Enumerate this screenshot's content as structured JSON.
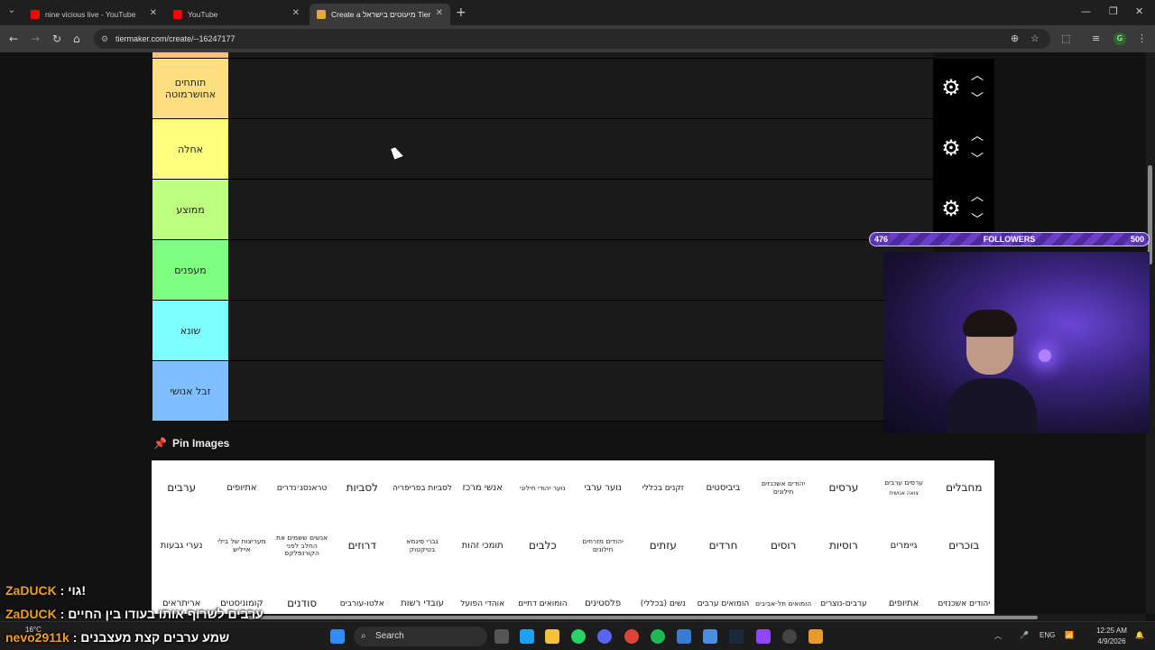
{
  "browser": {
    "tabs": [
      {
        "title": "nine vicious live - YouTube",
        "icon": "youtube-icon"
      },
      {
        "title": "YouTube",
        "icon": "youtube-icon"
      },
      {
        "title": "Create a מיעוטים בישראל Tier L",
        "icon": "tiermaker-icon",
        "active": true
      }
    ],
    "url": "tiermaker.com/create/--16247177"
  },
  "tier_list": {
    "tiers": [
      {
        "label": "",
        "color": "#ffbf7f"
      },
      {
        "label": "תותחים אחושרמוטה",
        "color": "#ffdf80"
      },
      {
        "label": "אחלה",
        "color": "#ffff7f"
      },
      {
        "label": "ממוצע",
        "color": "#bfff7f"
      },
      {
        "label": "מעפנים",
        "color": "#7fff7f"
      },
      {
        "label": "שונא",
        "color": "#7fffff"
      },
      {
        "label": "זבל אנושי",
        "color": "#7fbfff"
      }
    ]
  },
  "pin_images": {
    "title": "Pin Images",
    "rows": [
      [
        "מחבלים",
        "ערסים ערבים|צואה אנושית",
        "ערסים",
        "יהודים אשכנזים חילונים",
        "ביביסטים",
        "זקנים בכללי",
        "נוער ערבי",
        "נוער יהודי חילוני",
        "אנשי מרכז",
        "לסביות בפריפריה",
        "לסביות",
        "טראנסג׳נדרים",
        "אתיופים",
        "ערבים"
      ],
      [
        "בוכרים",
        "גיימרים",
        "רוסיות",
        "רוסים",
        "חרדים",
        "עזתים",
        "יהודים מזרחים חילונים",
        "כלבים",
        "תומכי זהות",
        "גברי סיגמא בטיקטוק",
        "דרוזים",
        "אנשים ששמים את החלב לפני הקורנפלקס",
        "מעריצות של בילי אייליש",
        "נערי גבעות"
      ],
      [
        "יהודים אשכנזים",
        "אתיופים",
        "ערבים-נוצרים",
        "הומואים תל-אביבים",
        "הומואים ערבים",
        "נשים (בכללי)",
        "פלסטינים",
        "הומואים דתיים",
        "אוהדי הפועל",
        "עובדי רשות",
        "אלטו-עורבים",
        "סודנים",
        "קומוניסטים",
        "אריתראים"
      ]
    ]
  },
  "stream": {
    "followers_current": "476",
    "followers_label": "FOLLOWERS",
    "followers_goal": "500",
    "chat": [
      {
        "user": "ZaDUCK",
        "message": "גוי!"
      },
      {
        "user": "ZaDUCK",
        "message": "ערבים לשרוף אותו בעודו בין החיים"
      },
      {
        "user": "nevo2911k",
        "message": "שמע ערבים קצת מעצבנים"
      }
    ]
  },
  "taskbar": {
    "weather": "16°C",
    "search_placeholder": "Search",
    "language": "ENG",
    "time": "12:25 AM",
    "date": "4/9/2026"
  }
}
